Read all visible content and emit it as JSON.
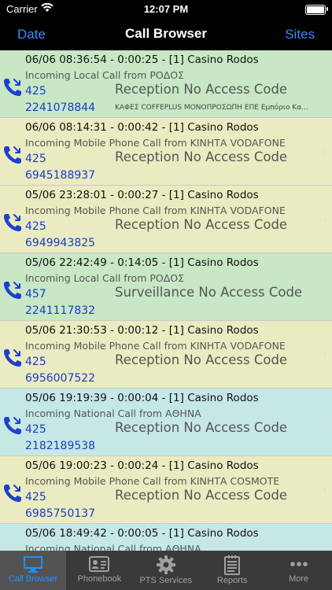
{
  "status": {
    "carrier": "Carrier",
    "time": "12:07 PM"
  },
  "nav": {
    "left": "Date",
    "title": "Call Browser",
    "right": "Sites"
  },
  "calls": [
    {
      "header": "06/06 08:36:54 - 0:00:25 - [1] Casino Rodos",
      "sub": "Incoming Local Call from ΡΟΔΟΣ",
      "ext": "425",
      "number": "2241078844",
      "code": "Reception No Access Code",
      "desc": "ΚΑΦΕΣ COFFEPLUS ΜΟΝΟΠΡΟΣΩΠΗ ΕΠΕ Εμπόριο Κα...",
      "color": "green"
    },
    {
      "header": "06/06 08:14:31 - 0:00:42 - [1] Casino Rodos",
      "sub": "Incoming Mobile Phone Call from ΚΙΝΗΤΑ VODAFONE",
      "ext": "425",
      "number": "6945188937",
      "code": "Reception No Access Code",
      "desc": "",
      "color": "yellow"
    },
    {
      "header": "05/06 23:28:01 - 0:00:27 - [1] Casino Rodos",
      "sub": "Incoming Mobile Phone Call from ΚΙΝΗΤΑ VODAFONE",
      "ext": "425",
      "number": "6949943825",
      "code": "Reception No Access Code",
      "desc": "",
      "color": "yellow"
    },
    {
      "header": "05/06 22:42:49 - 0:14:05 - [1] Casino Rodos",
      "sub": "Incoming Local Call from ΡΟΔΟΣ",
      "ext": "457",
      "number": "2241117832",
      "code": "Surveillance No Access Code",
      "desc": "",
      "color": "green"
    },
    {
      "header": "05/06 21:30:53 - 0:00:12 - [1] Casino Rodos",
      "sub": "Incoming Mobile Phone Call from ΚΙΝΗΤΑ VODAFONE",
      "ext": "425",
      "number": "6956007522",
      "code": "Reception No Access Code",
      "desc": "",
      "color": "yellow"
    },
    {
      "header": "05/06 19:19:39 - 0:00:04 - [1] Casino Rodos",
      "sub": "Incoming National Call from ΑΘΗΝΑ",
      "ext": "425",
      "number": "2182189538",
      "code": "Reception No Access Code",
      "desc": "",
      "color": "cyan"
    },
    {
      "header": "05/06 19:00:23 - 0:00:24 - [1] Casino Rodos",
      "sub": "Incoming Mobile Phone Call from ΚΙΝΗΤΑ COSMOTE",
      "ext": "425",
      "number": "6985750137",
      "code": "Reception No Access Code",
      "desc": "",
      "color": "yellow"
    },
    {
      "header": "05/06 18:49:42 - 0:00:05 - [1] Casino Rodos",
      "sub": "Incoming National Call from ΑΘΗΝΑ",
      "ext": "",
      "number": "",
      "code": "",
      "desc": "",
      "color": "cyan"
    }
  ],
  "tabs": [
    {
      "label": "Call Browser",
      "icon": "monitor-icon",
      "active": true
    },
    {
      "label": "Phonebook",
      "icon": "contact-card-icon",
      "active": false
    },
    {
      "label": "PTS Services",
      "icon": "gear-icon",
      "active": false
    },
    {
      "label": "Reports",
      "icon": "report-icon",
      "active": false
    },
    {
      "label": "More",
      "icon": "more-icon",
      "active": false
    }
  ],
  "colors": {
    "accent": "#1e90ff",
    "link": "#3a8cff",
    "green_row": "#c8e7c5",
    "yellow_row": "#ebebc1",
    "cyan_row": "#c6e8e5"
  }
}
